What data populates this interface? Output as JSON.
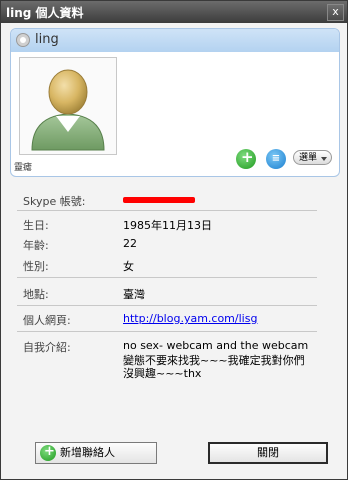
{
  "window": {
    "title": "ling 個人資料",
    "close_glyph": "x"
  },
  "card": {
    "name": "ling",
    "avatar_label": "靈瘧",
    "options_label": "選單"
  },
  "fields": {
    "skype_label": "Skype 帳號:",
    "birthday_label": "生日:",
    "birthday_value": "1985年11月13日",
    "age_label": "年齡:",
    "age_value": "22",
    "gender_label": "性別:",
    "gender_value": "女",
    "location_label": "地點:",
    "location_value": "臺灣",
    "homepage_label": "個人網頁:",
    "homepage_value": "http://blog.yam.com/lisg",
    "about_label": "自我介紹:",
    "about_lines": [
      "no sex- webcam and the webcam",
      "變態不要來找我~~~我確定我對你們",
      "沒興趣~~~thx"
    ]
  },
  "buttons": {
    "add_contact": "新增聯絡人",
    "close": "關閉"
  },
  "colors": {
    "titlebar": "#4a4a4a",
    "card_header": "#c4dcf4",
    "redaction": "#ff0000",
    "link": "#0000ee"
  }
}
